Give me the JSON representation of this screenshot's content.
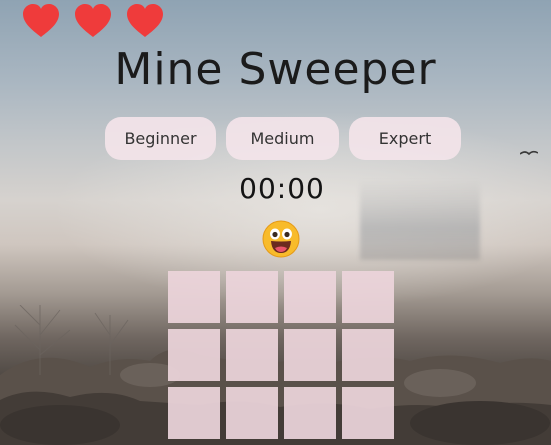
{
  "lives": {
    "count": 3,
    "icon": "heart-icon",
    "color": "#ef3b3b"
  },
  "title": "Mine Sweeper",
  "difficulty": {
    "options": [
      "Beginner",
      "Medium",
      "Expert"
    ]
  },
  "timer": "00:00",
  "status_icon": "smiley-face-icon",
  "board": {
    "columns": 4,
    "visible_rows": 3,
    "cell_color": "#ecd4da",
    "state": "covered"
  }
}
